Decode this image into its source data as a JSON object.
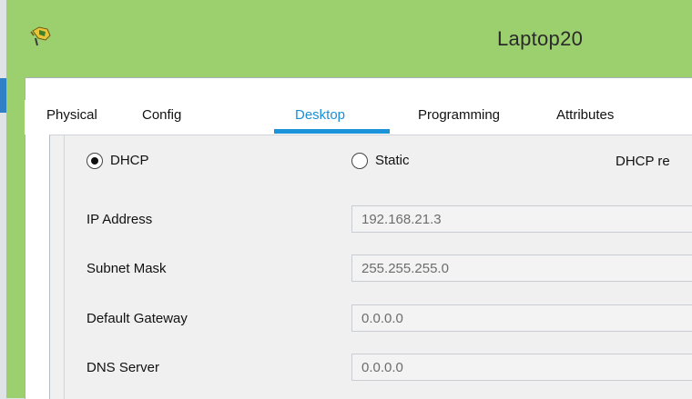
{
  "window": {
    "title": "Laptop20"
  },
  "tabs": [
    {
      "label": "Physical"
    },
    {
      "label": "Config"
    },
    {
      "label": "Desktop"
    },
    {
      "label": "Programming"
    },
    {
      "label": "Attributes"
    }
  ],
  "active_tab": "Desktop",
  "ip_config": {
    "dhcp_label": "DHCP",
    "dhcp_selected": true,
    "static_label": "Static",
    "static_selected": false,
    "dhcp_status": "DHCP re",
    "fields": [
      {
        "label": "IP Address",
        "value": "192.168.21.3"
      },
      {
        "label": "Subnet Mask",
        "value": "255.255.255.0"
      },
      {
        "label": "Default Gateway",
        "value": "0.0.0.0"
      },
      {
        "label": "DNS Server",
        "value": "0.0.0.0"
      }
    ]
  },
  "colors": {
    "title_bar": "#9ccf6e",
    "accent": "#1b93d9",
    "panel": "#f0f0f0"
  }
}
